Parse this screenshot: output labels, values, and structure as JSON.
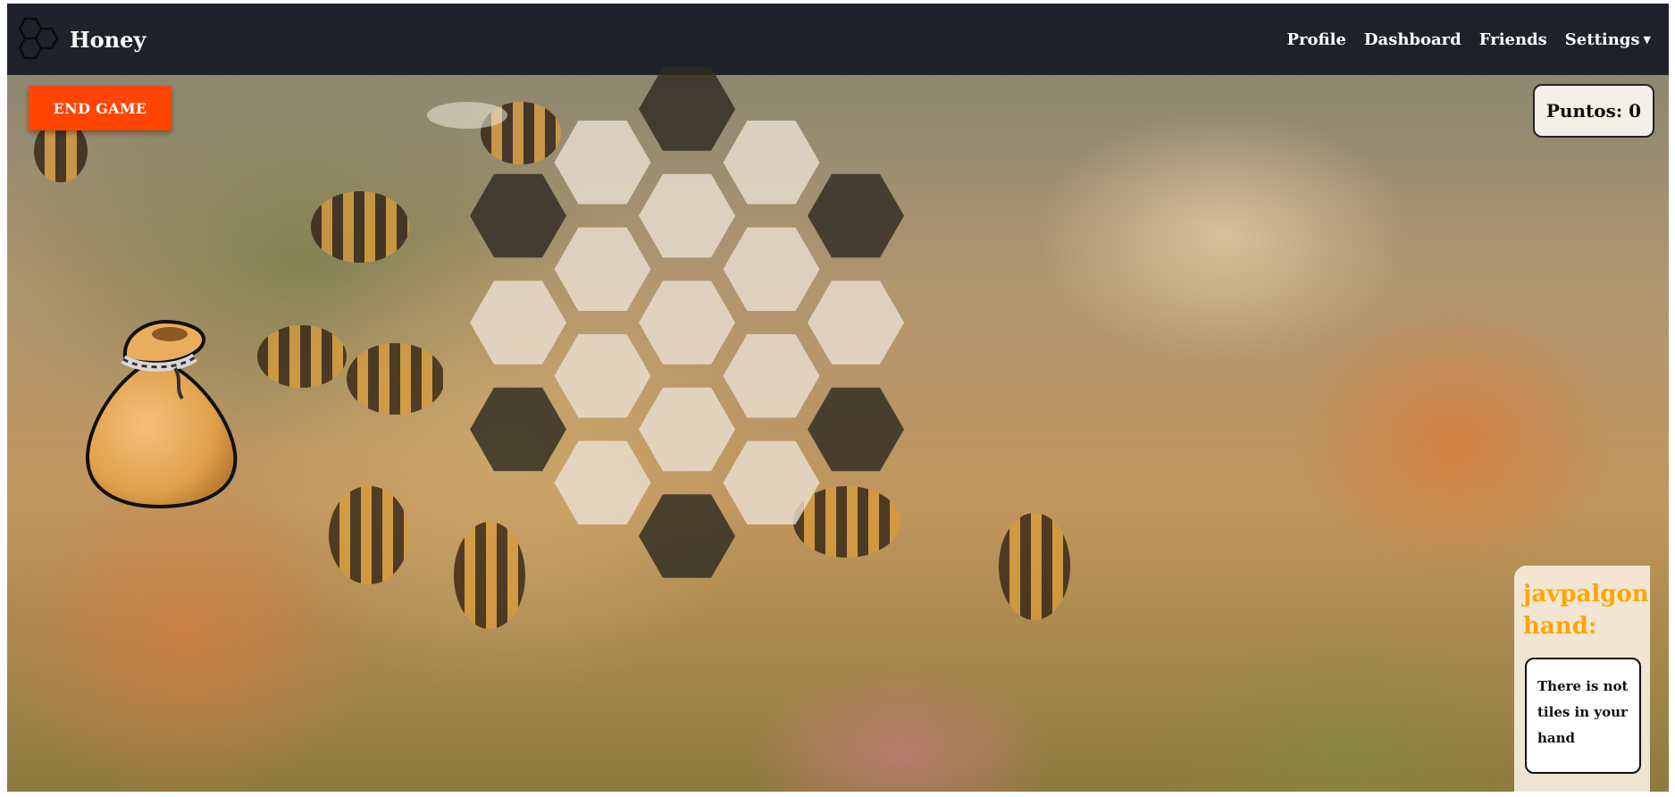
{
  "navbar": {
    "brand": "Honey",
    "links": {
      "profile": "Profile",
      "dashboard": "Dashboard",
      "friends": "Friends",
      "settings": "Settings"
    }
  },
  "game": {
    "end_game_label": "END GAME",
    "score_text": "Puntos: 0"
  },
  "hand": {
    "title": "javpalgon hand:",
    "empty_message": "There is not tiles in your hand"
  },
  "board": {
    "tile_legend": {
      "dark": "occupied",
      "light": "empty"
    },
    "tiles": [
      {
        "col": 2,
        "row": 0,
        "state": "dark"
      },
      {
        "col": 1,
        "row": 1,
        "state": "light"
      },
      {
        "col": 3,
        "row": 1,
        "state": "light"
      },
      {
        "col": 0,
        "row": 2,
        "state": "dark"
      },
      {
        "col": 2,
        "row": 2,
        "state": "light"
      },
      {
        "col": 4,
        "row": 2,
        "state": "dark"
      },
      {
        "col": 1,
        "row": 3,
        "state": "light"
      },
      {
        "col": 3,
        "row": 3,
        "state": "light"
      },
      {
        "col": 0,
        "row": 4,
        "state": "light"
      },
      {
        "col": 2,
        "row": 4,
        "state": "light"
      },
      {
        "col": 4,
        "row": 4,
        "state": "light"
      },
      {
        "col": 1,
        "row": 5,
        "state": "light"
      },
      {
        "col": 3,
        "row": 5,
        "state": "light"
      },
      {
        "col": 0,
        "row": 6,
        "state": "dark"
      },
      {
        "col": 2,
        "row": 6,
        "state": "light"
      },
      {
        "col": 4,
        "row": 6,
        "state": "dark"
      },
      {
        "col": 1,
        "row": 7,
        "state": "light"
      },
      {
        "col": 3,
        "row": 7,
        "state": "light"
      },
      {
        "col": 2,
        "row": 8,
        "state": "dark"
      }
    ]
  },
  "colors": {
    "navbar_bg": "#1f2329",
    "end_game_bg": "#ff4500",
    "hand_title": "#ffa500",
    "tile_dark": "#2f2b22",
    "tile_light": "#ebe0d3"
  },
  "icons": [
    "honeycomb-logo-icon",
    "caret-down-icon",
    "tile-bag-icon"
  ]
}
